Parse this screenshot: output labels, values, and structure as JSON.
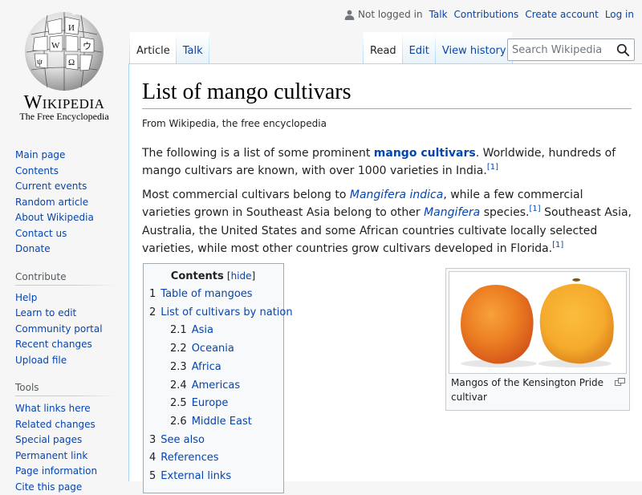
{
  "logo": {
    "wordmark": "Wikipedia",
    "tagline": "The Free Encyclopedia"
  },
  "sidebar": {
    "navigation": [
      {
        "label": "Main page",
        "name": "sidebar-item-main-page"
      },
      {
        "label": "Contents",
        "name": "sidebar-item-contents"
      },
      {
        "label": "Current events",
        "name": "sidebar-item-current-events"
      },
      {
        "label": "Random article",
        "name": "sidebar-item-random-article"
      },
      {
        "label": "About Wikipedia",
        "name": "sidebar-item-about-wikipedia"
      },
      {
        "label": "Contact us",
        "name": "sidebar-item-contact-us"
      },
      {
        "label": "Donate",
        "name": "sidebar-item-donate"
      }
    ],
    "contribute_heading": "Contribute",
    "contribute": [
      {
        "label": "Help",
        "name": "sidebar-item-help"
      },
      {
        "label": "Learn to edit",
        "name": "sidebar-item-learn-to-edit"
      },
      {
        "label": "Community portal",
        "name": "sidebar-item-community-portal"
      },
      {
        "label": "Recent changes",
        "name": "sidebar-item-recent-changes"
      },
      {
        "label": "Upload file",
        "name": "sidebar-item-upload-file"
      }
    ],
    "tools_heading": "Tools",
    "tools": [
      {
        "label": "What links here",
        "name": "sidebar-item-what-links-here"
      },
      {
        "label": "Related changes",
        "name": "sidebar-item-related-changes"
      },
      {
        "label": "Special pages",
        "name": "sidebar-item-special-pages"
      },
      {
        "label": "Permanent link",
        "name": "sidebar-item-permanent-link"
      },
      {
        "label": "Page information",
        "name": "sidebar-item-page-information"
      },
      {
        "label": "Cite this page",
        "name": "sidebar-item-cite-this-page"
      }
    ]
  },
  "personal": {
    "not_logged_in": "Not logged in",
    "talk": "Talk",
    "contributions": "Contributions",
    "create_account": "Create account",
    "login": "Log in"
  },
  "tabs": {
    "article": "Article",
    "talk": "Talk",
    "read": "Read",
    "edit": "Edit",
    "view_history": "View history"
  },
  "search": {
    "placeholder": "Search Wikipedia"
  },
  "page": {
    "title": "List of mango cultivars",
    "site_sub": "From Wikipedia, the free encyclopedia",
    "p1": {
      "t1": "The following is a list of some prominent ",
      "link": "mango cultivars",
      "t2": ". Worldwide, hundreds of mango cultivars are known, with over 1000 varieties in India.",
      "ref": "[1]"
    },
    "p2": {
      "t1": "Most commercial cultivars belong to ",
      "link1": "Mangifera indica",
      "t2": ", while a few commercial varieties grown in Southeast Asia belong to other ",
      "link2": "Mangifera",
      "t3": " species.",
      "ref1": "[1]",
      "t4": " Southeast Asia, Australia, the United States and some African countries cultivate locally selected varieties, while most other countries grow cultivars developed in Florida.",
      "ref2": "[1]"
    }
  },
  "toc": {
    "title": "Contents",
    "hide": "hide",
    "items": [
      {
        "num": "1",
        "label": "Table of mangoes",
        "sub": false
      },
      {
        "num": "2",
        "label": "List of cultivars by nation",
        "sub": false
      },
      {
        "num": "2.1",
        "label": "Asia",
        "sub": true
      },
      {
        "num": "2.2",
        "label": "Oceania",
        "sub": true
      },
      {
        "num": "2.3",
        "label": "Africa",
        "sub": true
      },
      {
        "num": "2.4",
        "label": "Americas",
        "sub": true
      },
      {
        "num": "2.5",
        "label": "Europe",
        "sub": true
      },
      {
        "num": "2.6",
        "label": "Middle East",
        "sub": true
      },
      {
        "num": "3",
        "label": "See also",
        "sub": false
      },
      {
        "num": "4",
        "label": "References",
        "sub": false
      },
      {
        "num": "5",
        "label": "External links",
        "sub": false
      }
    ]
  },
  "thumb": {
    "caption": "Mangos of the Kensington Pride cultivar"
  },
  "colors": {
    "link": "#0645ad",
    "background": "#f6f6f6",
    "content_border": "#a7d7f9"
  }
}
